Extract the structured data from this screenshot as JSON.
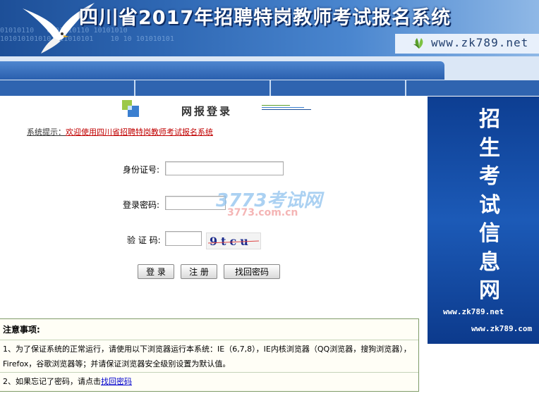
{
  "banner": {
    "title": "四川省2017年招聘特岗教师考试报名系统",
    "site_url": "www.zk789.net",
    "binary_text": "01010110   0101010110 10101010\n1010101010101011010101    10 10 101010101"
  },
  "login": {
    "title": "网报登录",
    "hint_label": "系统提示：",
    "hint_text": "欢迎使用四川省招聘特岗教师考试报名系统",
    "id_label": "身份证号:",
    "id_value": "",
    "password_label": "登录密码:",
    "password_value": "",
    "captcha_label": "验 证 码:",
    "captcha_value": "",
    "captcha_text": "9tcu",
    "login_button": "登 录",
    "register_button": "注 册",
    "recover_button": "找回密码"
  },
  "watermark": {
    "brand": "3773考试网",
    "url": "3773.com.cn"
  },
  "notice": {
    "title": "注意事项:",
    "item1": "1、为了保证系统的正常运行，请使用以下浏览器运行本系统：IE（6,7,8），IE内核浏览器（QQ浏览器，搜狗浏览器），Firefox，谷歌浏览器等；并请保证浏览器安全级别设置为默认值。",
    "item2_prefix": "2、如果忘记了密码，请点击",
    "item2_link": "找回密码"
  },
  "ad": {
    "text": "招生考试信息网",
    "url1": "www.zk789.net",
    "url2": "www.zk789.com"
  },
  "colors": {
    "banner_blue": "#2e67b3",
    "nav_blue": "#2f64b0",
    "ad_blue": "#1c5ab7",
    "hint_red": "#c00000",
    "notice_border": "#7f9b67"
  },
  "icons": {
    "bird": "seagull-icon",
    "leaf": "leaf-logo-icon",
    "login": "login-cube-icon"
  }
}
